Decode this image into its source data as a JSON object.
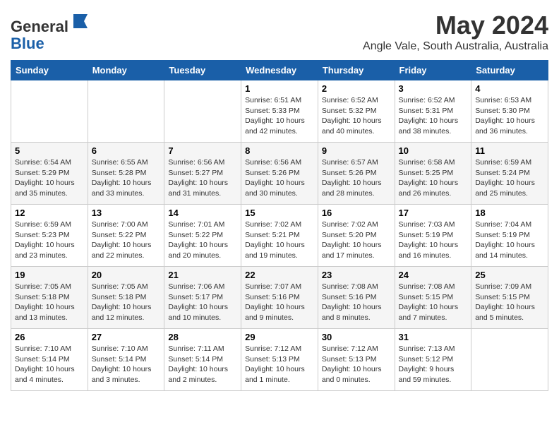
{
  "header": {
    "logo_line1": "General",
    "logo_line2": "Blue",
    "month_title": "May 2024",
    "location": "Angle Vale, South Australia, Australia"
  },
  "days_of_week": [
    "Sunday",
    "Monday",
    "Tuesday",
    "Wednesday",
    "Thursday",
    "Friday",
    "Saturday"
  ],
  "weeks": [
    [
      {
        "day": "",
        "info": ""
      },
      {
        "day": "",
        "info": ""
      },
      {
        "day": "",
        "info": ""
      },
      {
        "day": "1",
        "info": "Sunrise: 6:51 AM\nSunset: 5:33 PM\nDaylight: 10 hours\nand 42 minutes."
      },
      {
        "day": "2",
        "info": "Sunrise: 6:52 AM\nSunset: 5:32 PM\nDaylight: 10 hours\nand 40 minutes."
      },
      {
        "day": "3",
        "info": "Sunrise: 6:52 AM\nSunset: 5:31 PM\nDaylight: 10 hours\nand 38 minutes."
      },
      {
        "day": "4",
        "info": "Sunrise: 6:53 AM\nSunset: 5:30 PM\nDaylight: 10 hours\nand 36 minutes."
      }
    ],
    [
      {
        "day": "5",
        "info": "Sunrise: 6:54 AM\nSunset: 5:29 PM\nDaylight: 10 hours\nand 35 minutes."
      },
      {
        "day": "6",
        "info": "Sunrise: 6:55 AM\nSunset: 5:28 PM\nDaylight: 10 hours\nand 33 minutes."
      },
      {
        "day": "7",
        "info": "Sunrise: 6:56 AM\nSunset: 5:27 PM\nDaylight: 10 hours\nand 31 minutes."
      },
      {
        "day": "8",
        "info": "Sunrise: 6:56 AM\nSunset: 5:26 PM\nDaylight: 10 hours\nand 30 minutes."
      },
      {
        "day": "9",
        "info": "Sunrise: 6:57 AM\nSunset: 5:26 PM\nDaylight: 10 hours\nand 28 minutes."
      },
      {
        "day": "10",
        "info": "Sunrise: 6:58 AM\nSunset: 5:25 PM\nDaylight: 10 hours\nand 26 minutes."
      },
      {
        "day": "11",
        "info": "Sunrise: 6:59 AM\nSunset: 5:24 PM\nDaylight: 10 hours\nand 25 minutes."
      }
    ],
    [
      {
        "day": "12",
        "info": "Sunrise: 6:59 AM\nSunset: 5:23 PM\nDaylight: 10 hours\nand 23 minutes."
      },
      {
        "day": "13",
        "info": "Sunrise: 7:00 AM\nSunset: 5:22 PM\nDaylight: 10 hours\nand 22 minutes."
      },
      {
        "day": "14",
        "info": "Sunrise: 7:01 AM\nSunset: 5:22 PM\nDaylight: 10 hours\nand 20 minutes."
      },
      {
        "day": "15",
        "info": "Sunrise: 7:02 AM\nSunset: 5:21 PM\nDaylight: 10 hours\nand 19 minutes."
      },
      {
        "day": "16",
        "info": "Sunrise: 7:02 AM\nSunset: 5:20 PM\nDaylight: 10 hours\nand 17 minutes."
      },
      {
        "day": "17",
        "info": "Sunrise: 7:03 AM\nSunset: 5:19 PM\nDaylight: 10 hours\nand 16 minutes."
      },
      {
        "day": "18",
        "info": "Sunrise: 7:04 AM\nSunset: 5:19 PM\nDaylight: 10 hours\nand 14 minutes."
      }
    ],
    [
      {
        "day": "19",
        "info": "Sunrise: 7:05 AM\nSunset: 5:18 PM\nDaylight: 10 hours\nand 13 minutes."
      },
      {
        "day": "20",
        "info": "Sunrise: 7:05 AM\nSunset: 5:18 PM\nDaylight: 10 hours\nand 12 minutes."
      },
      {
        "day": "21",
        "info": "Sunrise: 7:06 AM\nSunset: 5:17 PM\nDaylight: 10 hours\nand 10 minutes."
      },
      {
        "day": "22",
        "info": "Sunrise: 7:07 AM\nSunset: 5:16 PM\nDaylight: 10 hours\nand 9 minutes."
      },
      {
        "day": "23",
        "info": "Sunrise: 7:08 AM\nSunset: 5:16 PM\nDaylight: 10 hours\nand 8 minutes."
      },
      {
        "day": "24",
        "info": "Sunrise: 7:08 AM\nSunset: 5:15 PM\nDaylight: 10 hours\nand 7 minutes."
      },
      {
        "day": "25",
        "info": "Sunrise: 7:09 AM\nSunset: 5:15 PM\nDaylight: 10 hours\nand 5 minutes."
      }
    ],
    [
      {
        "day": "26",
        "info": "Sunrise: 7:10 AM\nSunset: 5:14 PM\nDaylight: 10 hours\nand 4 minutes."
      },
      {
        "day": "27",
        "info": "Sunrise: 7:10 AM\nSunset: 5:14 PM\nDaylight: 10 hours\nand 3 minutes."
      },
      {
        "day": "28",
        "info": "Sunrise: 7:11 AM\nSunset: 5:14 PM\nDaylight: 10 hours\nand 2 minutes."
      },
      {
        "day": "29",
        "info": "Sunrise: 7:12 AM\nSunset: 5:13 PM\nDaylight: 10 hours\nand 1 minute."
      },
      {
        "day": "30",
        "info": "Sunrise: 7:12 AM\nSunset: 5:13 PM\nDaylight: 10 hours\nand 0 minutes."
      },
      {
        "day": "31",
        "info": "Sunrise: 7:13 AM\nSunset: 5:12 PM\nDaylight: 9 hours\nand 59 minutes."
      },
      {
        "day": "",
        "info": ""
      }
    ]
  ]
}
